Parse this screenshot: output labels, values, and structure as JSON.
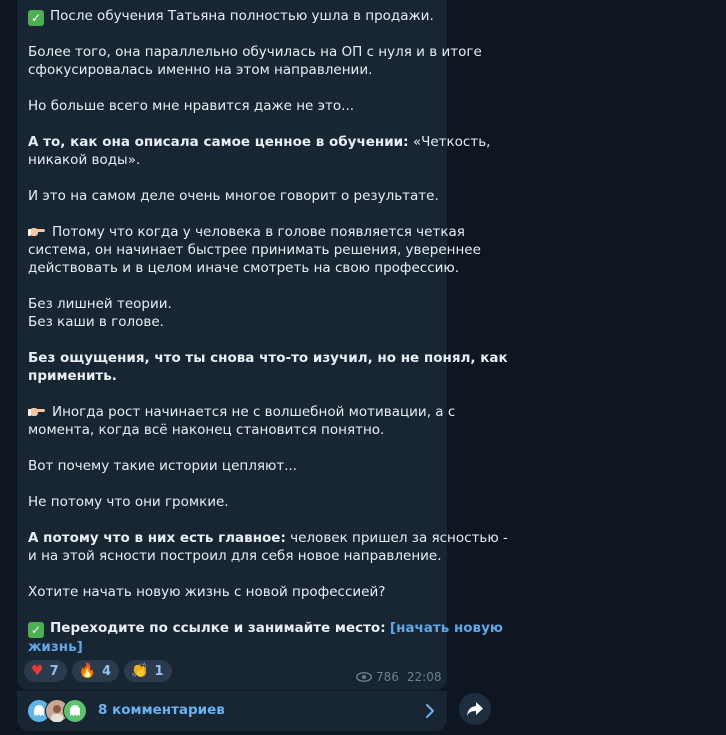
{
  "message": {
    "p1": "После обучения Татьяна полностью ушла в продажи.",
    "p2_l1": "Более того, она параллельно обучилась на ОП с нуля и в итоге",
    "p2_l2": "сфокусировалась именно на этом направлении.",
    "p3": "Но больше всего мне нравится даже не это...",
    "p4_bold": "А то, как она описала самое ценное в обучении:",
    "p4_l1_rest": " «Четкость,",
    "p4_l2": "никакой воды».",
    "p5": "И это на самом деле очень многое говорит о результате.",
    "p6_l1": "Потому что когда у человека в голове появляется четкая",
    "p6_l2": "система, он начинает быстрее принимать решения, увереннее",
    "p6_l3": "действовать и в целом иначе смотреть на свою профессию.",
    "p7_l1": "Без лишней теории.",
    "p7_l2": "Без каши в голове.",
    "p8_l1": "Без ощущения, что ты снова что-то изучил, но не понял, как",
    "p8_l2": "применить.",
    "p9_l1": "Иногда рост начинается не с волшебной мотивации, а с",
    "p9_l2": "момента, когда всё наконец становится понятно.",
    "p10": "Вот почему такие истории цепляют...",
    "p11": "Не потому что они громкие.",
    "p12_bold": "А потому что в них есть главное:",
    "p12_l1_rest": " человек пришел за ясностью -",
    "p12_l2": "и на этой ясности построил для себя новое направление.",
    "p13": "Хотите начать новую жизнь с новой профессией?",
    "p14_bold": "Переходите по ссылке и занимайте место:",
    "p14_link_l1": "[начать новую",
    "p14_link_l2": "жизнь]"
  },
  "reactions": [
    {
      "icon": "heart",
      "count": "7"
    },
    {
      "icon": "fire",
      "count": "4"
    },
    {
      "icon": "clap",
      "count": "1"
    }
  ],
  "views": "786",
  "time": "22:08",
  "comments_label": "8 комментариев",
  "colors": {
    "background": "#0e1621",
    "bubble": "#182533",
    "link": "#5fa8e6",
    "accent": "#6ab3f3"
  }
}
